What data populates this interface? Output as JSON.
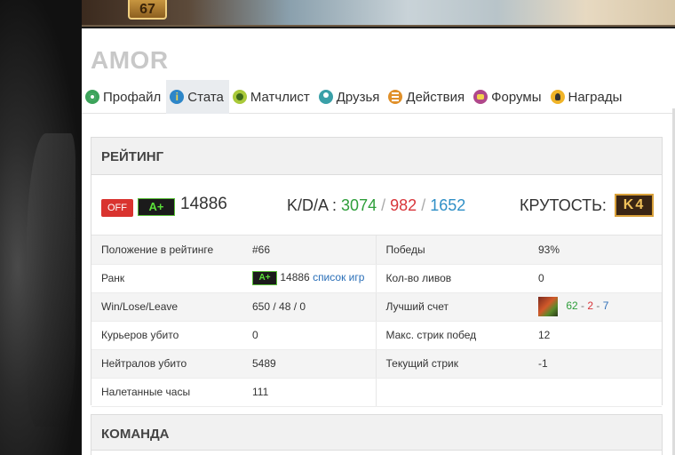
{
  "banner": {
    "level": "67"
  },
  "player": {
    "name": "AMOR"
  },
  "tabs": [
    {
      "label": "Профайл",
      "icon": "profile-icon"
    },
    {
      "label": "Стата",
      "icon": "stats-icon",
      "active": true
    },
    {
      "label": "Матчлист",
      "icon": "matchlist-icon"
    },
    {
      "label": "Друзья",
      "icon": "friends-icon"
    },
    {
      "label": "Действия",
      "icon": "actions-icon"
    },
    {
      "label": "Форумы",
      "icon": "forums-icon"
    },
    {
      "label": "Награды",
      "icon": "awards-icon"
    }
  ],
  "rating": {
    "header": "РЕЙТИНГ",
    "off_label": "OFF",
    "rank_badge": "A+",
    "value": "14886",
    "kda_label": "K/D/A :",
    "kills": "3074",
    "deaths": "982",
    "assists": "1652",
    "sep": "/",
    "coolness_label": "КРУТОСТЬ:",
    "coolness_value": "K4",
    "colors": {
      "kills": "#2e9e3a",
      "deaths": "#d8353a",
      "assists": "#2f8fc6",
      "off": "#d9332f",
      "rank": "#5be03a"
    }
  },
  "stats": {
    "rows": [
      {
        "l1": "Положение в рейтинге",
        "v1": "#66",
        "l2": "Победы",
        "v2": "93%"
      },
      {
        "l1": "Ранк",
        "v1": "14886",
        "v1_badge": "A+",
        "v1_link": "список игр",
        "l2": "Кол-во ливов",
        "v2": "0"
      },
      {
        "l1": "Win/Lose/Leave",
        "v1": "650 / 48 / 0",
        "l2": "Лучший счет",
        "best": {
          "k": "62",
          "d": "2",
          "a": "7",
          "sep": "-"
        }
      },
      {
        "l1": "Курьеров убито",
        "v1": "0",
        "l2": "Макс. стрик побед",
        "v2": "12"
      },
      {
        "l1": "Нейтралов убито",
        "v1": "5489",
        "l2": "Текущий стрик",
        "v2": "-1"
      },
      {
        "l1": "Налетанные часы",
        "v1": "111",
        "l2": "",
        "v2": ""
      }
    ]
  },
  "team": {
    "header": "КОМАНДА"
  }
}
